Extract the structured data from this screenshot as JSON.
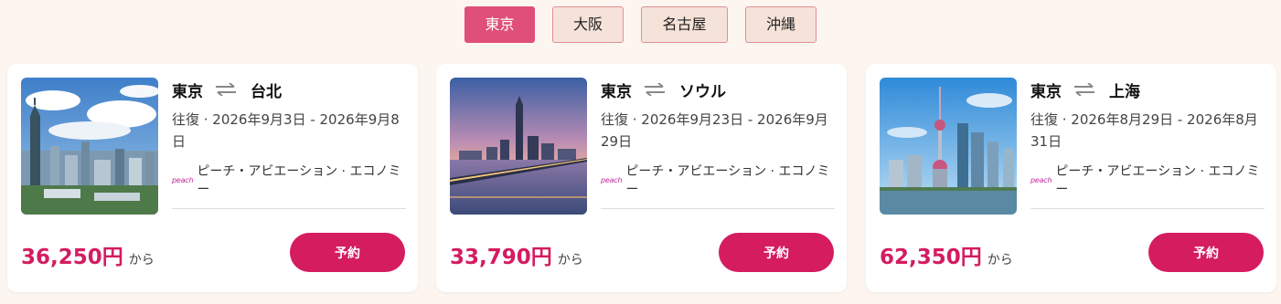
{
  "tabs": [
    {
      "label": "東京",
      "active": true
    },
    {
      "label": "大阪",
      "active": false
    },
    {
      "label": "名古屋",
      "active": false
    },
    {
      "label": "沖縄",
      "active": false
    }
  ],
  "cards": [
    {
      "from": "東京",
      "to": "台北",
      "dates": "往復 · 2026年9月3日 - 2026年9月8日",
      "airline_logo": "peach",
      "airline": "ピーチ・アビエーション · エコノミー",
      "price": "36,250円",
      "price_suffix": "から",
      "book_label": "予約"
    },
    {
      "from": "東京",
      "to": "ソウル",
      "dates": "往復 · 2026年9月23日 - 2026年9月29日",
      "airline_logo": "peach",
      "airline": "ピーチ・アビエーション · エコノミー",
      "price": "33,790円",
      "price_suffix": "から",
      "book_label": "予約"
    },
    {
      "from": "東京",
      "to": "上海",
      "dates": "往復 · 2026年8月29日 - 2026年8月31日",
      "airline_logo": "peach",
      "airline": "ピーチ・アビエーション · エコノミー",
      "price": "62,350円",
      "price_suffix": "から",
      "book_label": "予約"
    }
  ],
  "colors": {
    "accent": "#d41c5f",
    "tab_active": "#e04f79",
    "tab_inactive": "#f5e2d8",
    "background": "#fdf6f0"
  },
  "icons": {
    "swap": "swap-arrows-icon"
  }
}
